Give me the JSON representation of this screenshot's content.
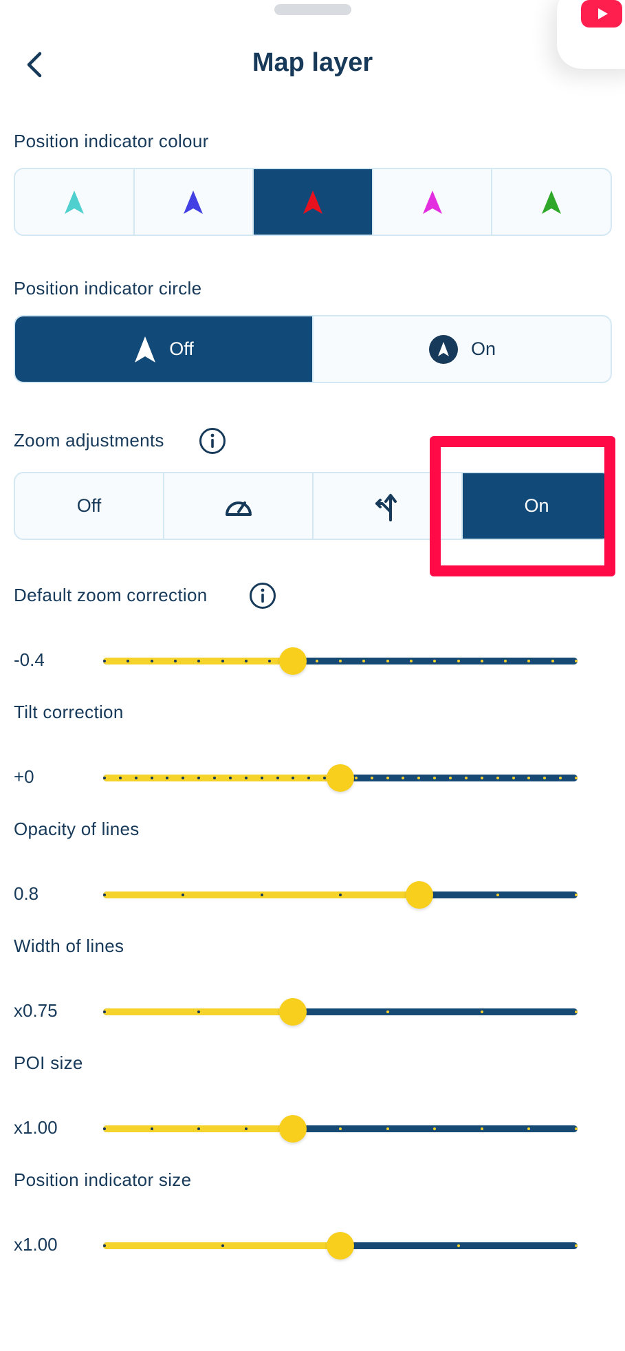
{
  "header": {
    "title": "Map layer"
  },
  "position_indicator_colour": {
    "label": "Position indicator colour",
    "options": [
      {
        "color": "#4fcfcd",
        "selected": false
      },
      {
        "color": "#4340e3",
        "selected": false
      },
      {
        "color": "#e8121f",
        "selected": true
      },
      {
        "color": "#e32ee0",
        "selected": false
      },
      {
        "color": "#2fa82a",
        "selected": false
      }
    ]
  },
  "position_indicator_circle": {
    "label": "Position indicator circle",
    "off_label": "Off",
    "on_label": "On",
    "selected": "off"
  },
  "zoom_adjustments": {
    "label": "Zoom adjustments",
    "off_label": "Off",
    "on_label": "On",
    "selected": "on"
  },
  "sliders": [
    {
      "id": "default-zoom-correction",
      "label": "Default zoom correction",
      "value_text": "-0.4",
      "position": 0.4,
      "ticks": 21,
      "info": true
    },
    {
      "id": "tilt-correction",
      "label": "Tilt correction",
      "value_text": "+0",
      "position": 0.5,
      "ticks": 31,
      "info": false
    },
    {
      "id": "opacity-of-lines",
      "label": "Opacity of lines",
      "value_text": "0.8",
      "position": 0.667,
      "ticks": 7,
      "info": false
    },
    {
      "id": "width-of-lines",
      "label": "Width of lines",
      "value_text": "x0.75",
      "position": 0.4,
      "ticks": 6,
      "info": false
    },
    {
      "id": "poi-size",
      "label": "POI size",
      "value_text": "x1.00",
      "position": 0.4,
      "ticks": 11,
      "info": false
    },
    {
      "id": "position-indicator-size",
      "label": "Position indicator size",
      "value_text": "x1.00",
      "position": 0.5,
      "ticks": 5,
      "info": false
    }
  ],
  "colors": {
    "accent": "#114a78",
    "slider_fill": "#f6d32a",
    "highlight": "#ff0a47"
  }
}
